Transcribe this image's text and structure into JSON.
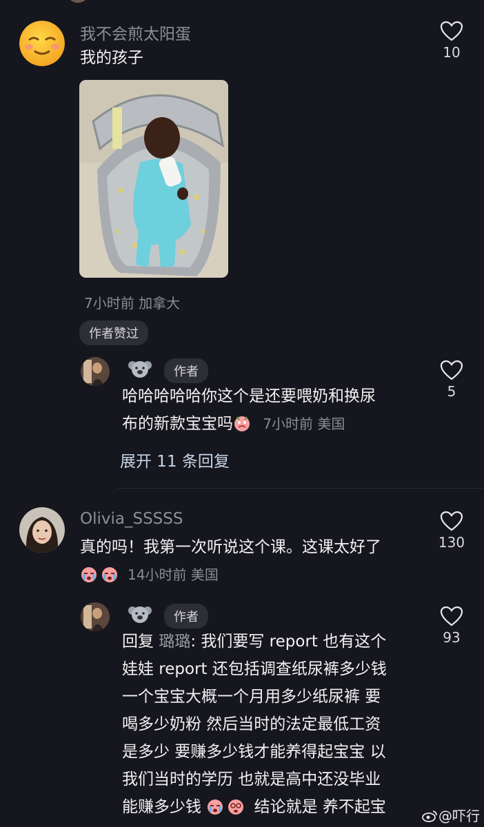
{
  "comments": [
    {
      "username": "我不会煎太阳蛋",
      "text": "我的孩子",
      "likes": "10",
      "meta": "7小时前 加拿大",
      "badge": "作者赞过",
      "reply": {
        "username_emoji": "koala-emoji",
        "author_tag": "作者",
        "line1": "哈哈哈哈哈你这个是还要喂奶和换尿",
        "line2": "布的新款宝宝吗",
        "meta": "7小时前 美国",
        "likes": "5"
      },
      "expand_label": "展开 11 条回复"
    },
    {
      "username": "Olivia_SSSSS",
      "text": "真的吗！我第一次听说这个课。这课太好了",
      "meta": "14小时前 美国",
      "likes": "130",
      "reply": {
        "username_emoji": "koala-emoji",
        "author_tag": "作者",
        "reply_prefix": "回复",
        "reply_to": "璐璐",
        "lines": [
          ": 我们要写 report 也有这个",
          "娃娃 report 还包括调查纸尿裤多少钱",
          "一个宝宝大概一个月用多少纸尿裤 要",
          "喝多少奶粉 然后当时的法定最低工资",
          "是多少 要赚多少钱才能养得起宝宝 以",
          "我们当时的学历 也就是高中还没毕业",
          "能赚多少钱",
          "结论就是 养不起宝"
        ],
        "likes": "93"
      }
    }
  ],
  "watermark": "@吓行",
  "colors": {
    "background": "#16161e",
    "name": "#8e8e96",
    "meta": "#8c8c94",
    "expand": "#c7d4e6"
  }
}
